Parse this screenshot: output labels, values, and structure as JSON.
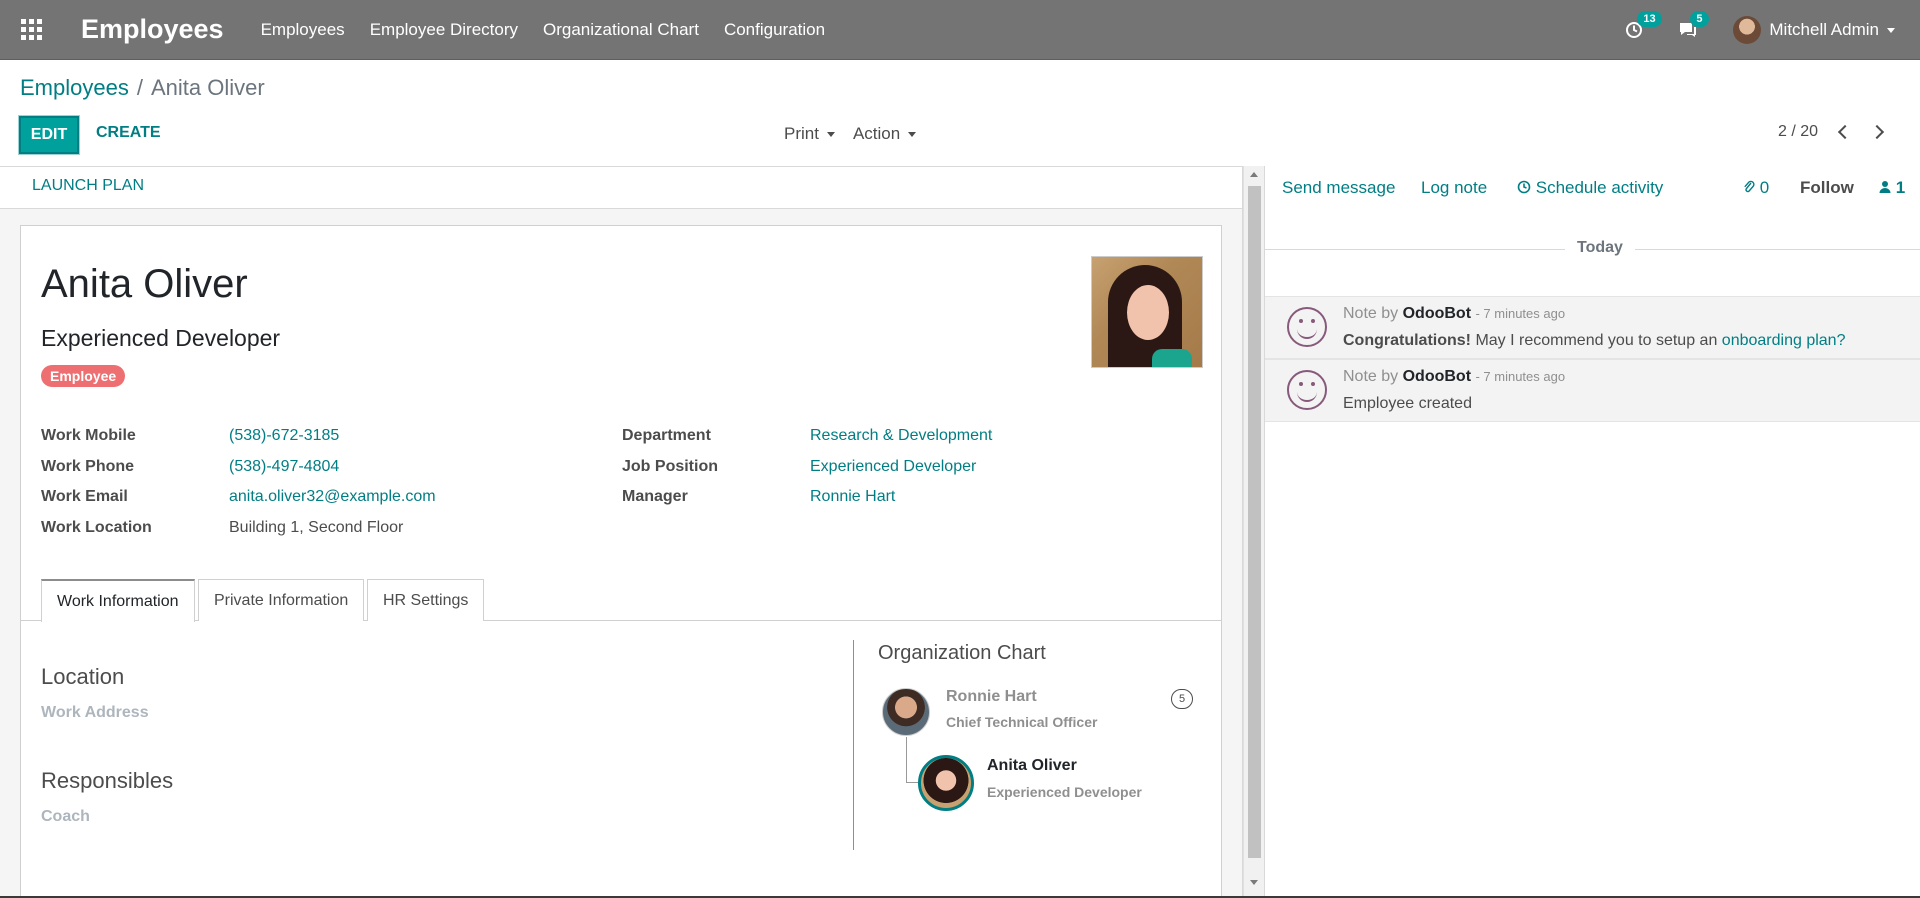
{
  "navbar": {
    "app_title": "Employees",
    "menu": [
      "Employees",
      "Employee Directory",
      "Organizational Chart",
      "Configuration"
    ],
    "activity_count": "13",
    "message_count": "5",
    "user_name": "Mitchell Admin"
  },
  "breadcrumb": {
    "parent": "Employees",
    "separator": "/",
    "current": "Anita Oliver"
  },
  "control_panel": {
    "edit_label": "EDIT",
    "create_label": "CREATE",
    "print_label": "Print",
    "action_label": "Action",
    "pager": "2 / 20"
  },
  "statusbar": {
    "launch_plan_label": "LAUNCH PLAN"
  },
  "employee": {
    "name": "Anita Oliver",
    "job_title": "Experienced Developer",
    "tag": "Employee",
    "tag_color": "#ee6f72",
    "left_fields": [
      {
        "label": "Work Mobile",
        "value": "(538)-672-3185",
        "link": true
      },
      {
        "label": "Work Phone",
        "value": "(538)-497-4804",
        "link": true
      },
      {
        "label": "Work Email",
        "value": "anita.oliver32@example.com",
        "link": true
      },
      {
        "label": "Work Location",
        "value": "Building 1, Second Floor",
        "link": false
      }
    ],
    "right_fields": [
      {
        "label": "Department",
        "value": "Research & Development",
        "link": true
      },
      {
        "label": "Job Position",
        "value": "Experienced Developer",
        "link": true
      },
      {
        "label": "Manager",
        "value": "Ronnie Hart",
        "link": true
      }
    ]
  },
  "tabs": [
    "Work Information",
    "Private Information",
    "HR Settings"
  ],
  "work_info": {
    "location_title": "Location",
    "work_address_label": "Work Address",
    "responsibles_title": "Responsibles",
    "coach_label": "Coach"
  },
  "org_chart": {
    "title": "Organization Chart",
    "manager_name": "Ronnie Hart",
    "manager_job": "Chief Technical Officer",
    "manager_count": "5",
    "self_name": "Anita Oliver",
    "self_job": "Experienced Developer"
  },
  "chatter": {
    "send_message": "Send message",
    "log_note": "Log note",
    "schedule_activity": "Schedule activity",
    "attachments_count": "0",
    "follow_label": "Follow",
    "followers_count": "1",
    "date_separator": "Today",
    "messages": [
      {
        "type_label": "Note by",
        "author": "OdooBot",
        "time": "- 7 minutes ago",
        "bold_text": "Congratulations!",
        "text": " May I recommend you to setup an ",
        "link_text": "onboarding plan?"
      },
      {
        "type_label": "Note by",
        "author": "OdooBot",
        "time": "- 7 minutes ago",
        "text": "Employee created"
      }
    ]
  },
  "colors": {
    "accent": "#017e84",
    "primary_button": "#00a09d",
    "navbar": "#747474"
  }
}
